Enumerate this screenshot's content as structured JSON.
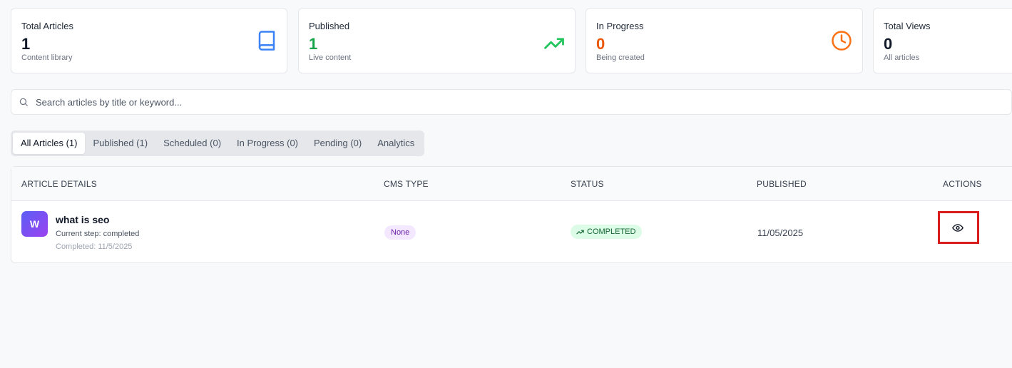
{
  "stats": [
    {
      "title": "Total Articles",
      "value": "1",
      "sub": "Content library",
      "icon": "book-icon",
      "value_color": "#111827",
      "icon_color": "#3b82f6"
    },
    {
      "title": "Published",
      "value": "1",
      "sub": "Live content",
      "icon": "trending-up-icon",
      "value_color": "#16a34a",
      "icon_color": "#22c55e"
    },
    {
      "title": "In Progress",
      "value": "0",
      "sub": "Being created",
      "icon": "clock-icon",
      "value_color": "#ea580c",
      "icon_color": "#f97316"
    },
    {
      "title": "Total Views",
      "value": "0",
      "sub": "All articles",
      "icon": "",
      "value_color": "#111827",
      "icon_color": ""
    }
  ],
  "search": {
    "placeholder": "Search articles by title or keyword..."
  },
  "tabs": [
    {
      "label": "All Articles (1)",
      "active": true
    },
    {
      "label": "Published (1)",
      "active": false
    },
    {
      "label": "Scheduled (0)",
      "active": false
    },
    {
      "label": "In Progress (0)",
      "active": false
    },
    {
      "label": "Pending (0)",
      "active": false
    },
    {
      "label": "Analytics",
      "active": false
    }
  ],
  "table": {
    "headers": {
      "details": "ARTICLE DETAILS",
      "cms": "CMS TYPE",
      "status": "STATUS",
      "published": "PUBLISHED",
      "actions": "ACTIONS"
    },
    "rows": [
      {
        "avatar": "W",
        "title": "what is seo",
        "step": "Current step: completed",
        "completed": "Completed: 11/5/2025",
        "cms": "None",
        "status": "COMPLETED",
        "published": "11/05/2025",
        "action_icon": "eye-icon"
      }
    ]
  },
  "colors": {
    "highlight": "#d91c1c",
    "status_bg": "#dcfce7",
    "cms_bg": "#f3e8ff"
  }
}
